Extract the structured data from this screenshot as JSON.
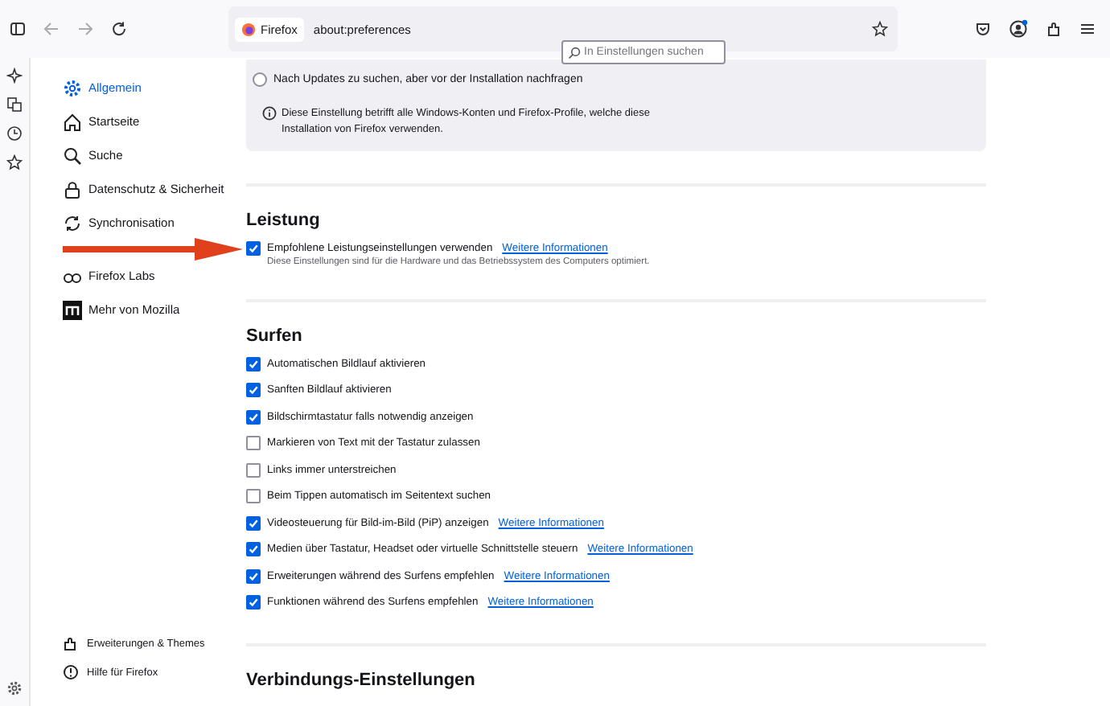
{
  "toolbar": {
    "identity": "Firefox",
    "url": "about:preferences"
  },
  "search": {
    "placeholder": "In Einstellungen suchen"
  },
  "nav": [
    {
      "label": "Allgemein",
      "selected": true
    },
    {
      "label": "Startseite",
      "selected": false
    },
    {
      "label": "Suche",
      "selected": false
    },
    {
      "label": "Datenschutz & Sicherheit",
      "selected": false
    },
    {
      "label": "Synchronisation",
      "selected": false
    },
    {
      "label": "Firefox Labs",
      "selected": false
    },
    {
      "label": "Mehr von Mozilla",
      "selected": false
    }
  ],
  "nav_footer": [
    "Erweiterungen & Themes",
    "Hilfe für Firefox"
  ],
  "updates": {
    "radio": {
      "label": "Nach Updates zu suchen, aber vor der Installation nachfragen",
      "selected": false
    },
    "note": "Diese Einstellung betrifft alle Windows-Konten und Firefox-Profile, welche diese Installation von Firefox verwenden."
  },
  "sections": [
    {
      "heading": "Leistung",
      "rows": [
        {
          "label": "Empfohlene Leistungseinstellungen verwenden",
          "checked": true,
          "link": "Weitere Informationen",
          "description": "Diese Einstellungen sind für die Hardware und das Betriebssystem des Computers optimiert."
        }
      ]
    },
    {
      "heading": "Surfen",
      "rows": [
        {
          "label": "Automatischen Bildlauf aktivieren",
          "checked": true
        },
        {
          "label": "Sanften Bildlauf aktivieren",
          "checked": true
        },
        {
          "label": "Bildschirmtastatur falls notwendig anzeigen",
          "checked": true
        },
        {
          "label": "Markieren von Text mit der Tastatur zulassen",
          "checked": false
        },
        {
          "label": "Links immer unterstreichen",
          "checked": false
        },
        {
          "label": "Beim Tippen automatisch im Seitentext suchen",
          "checked": false
        },
        {
          "label": "Videosteuerung für Bild-im-Bild (PiP) anzeigen",
          "checked": true,
          "link": "Weitere Informationen"
        },
        {
          "label": "Medien über Tastatur, Headset oder virtuelle Schnittstelle steuern",
          "checked": true,
          "link": "Weitere Informationen"
        },
        {
          "label": "Erweiterungen während des Surfens empfehlen",
          "checked": true,
          "link": "Weitere Informationen"
        },
        {
          "label": "Funktionen während des Surfens empfehlen",
          "checked": true,
          "link": "Weitere Informationen"
        }
      ]
    },
    {
      "heading": "Verbindungs-Einstellungen"
    }
  ]
}
